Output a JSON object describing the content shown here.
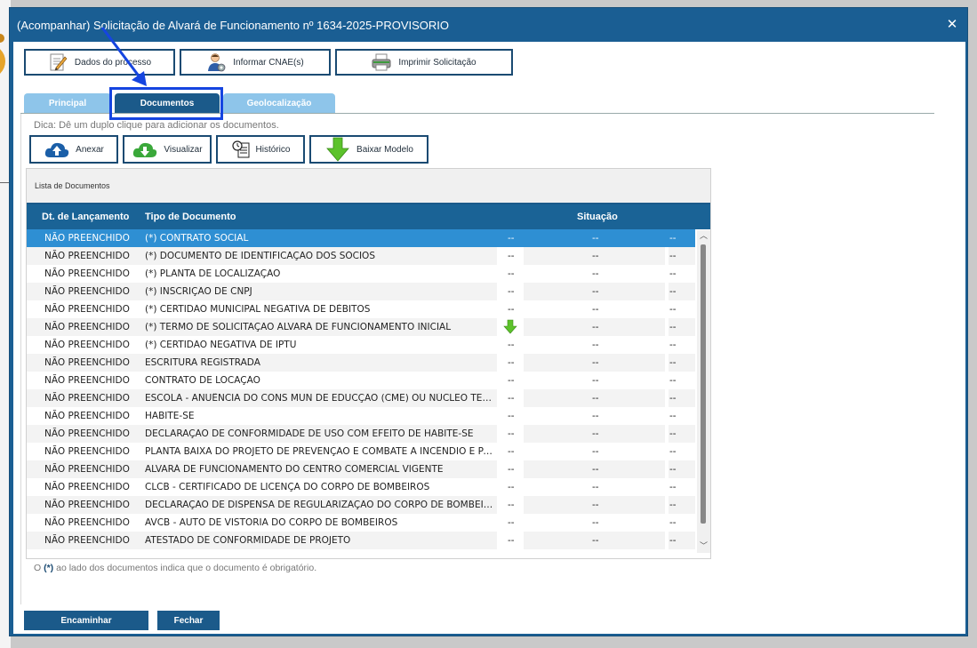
{
  "dialog": {
    "title": "(Acompanhar) Solicitação de Alvará de Funcionamento nº 1634-2025-PROVISORIO",
    "close_glyph": "✕"
  },
  "toolbar": [
    {
      "label": "Dados do processo",
      "icon": "edit-document-icon"
    },
    {
      "label": "Informar CNAE(s)",
      "icon": "user-settings-icon"
    },
    {
      "label": "Imprimir Solicitação",
      "icon": "printer-icon"
    }
  ],
  "tabs": [
    {
      "label": "Principal"
    },
    {
      "label": "Documentos",
      "active": true
    },
    {
      "label": "Geolocalização"
    }
  ],
  "hint": "Dica: Dê um duplo clique para adicionar os documentos.",
  "actions": [
    {
      "label": "Anexar",
      "icon": "cloud-upload-icon"
    },
    {
      "label": "Visualizar",
      "icon": "cloud-download-icon"
    },
    {
      "label": "Histórico",
      "icon": "history-icon"
    },
    {
      "label": "Baixar Modelo",
      "icon": "download-arrow-icon"
    }
  ],
  "list": {
    "caption": "Lista de Documentos",
    "columns": {
      "date": "Dt. de Lançamento",
      "type": "Tipo de Documento",
      "status": "Situação"
    },
    "rows": [
      {
        "date": "NÃO PREENCHIDO",
        "type": "(*) CONTRATO SOCIAL",
        "a": "--",
        "b": "--",
        "d": "--"
      },
      {
        "date": "NÃO PREENCHIDO",
        "type": "(*) DOCUMENTO DE IDENTIFICAÇÃO DOS SÓCIOS",
        "a": "--",
        "b": "--",
        "d": "--"
      },
      {
        "date": "NÃO PREENCHIDO",
        "type": "(*) PLANTA DE LOCALIZAÇÃO",
        "a": "--",
        "b": "--",
        "d": "--"
      },
      {
        "date": "NÃO PREENCHIDO",
        "type": "(*) INSCRIÇÃO DE CNPJ",
        "a": "--",
        "b": "--",
        "d": "--"
      },
      {
        "date": "NÃO PREENCHIDO",
        "type": "(*) CERTIDÃO MUNICIPAL NEGATIVA DE DÉBITOS",
        "a": "--",
        "b": "--",
        "d": "--"
      },
      {
        "date": "NÃO PREENCHIDO",
        "type": "(*) TERMO DE SOLICITAÇÃO ALVARÁ DE FUNCIONAMENTO INICIAL",
        "a": "",
        "download": true,
        "b": "--",
        "d": "--"
      },
      {
        "date": "NÃO PREENCHIDO",
        "type": "(*) CERTIDÃO NEGATIVA DE IPTU",
        "a": "--",
        "b": "--",
        "d": "--"
      },
      {
        "date": "NÃO PREENCHIDO",
        "type": "ESCRITURA REGISTRADA",
        "a": "--",
        "b": "--",
        "d": "--"
      },
      {
        "date": "NÃO PREENCHIDO",
        "type": "CONTRATO DE LOCAÇÃO",
        "a": "--",
        "b": "--",
        "d": "--"
      },
      {
        "date": "NÃO PREENCHIDO",
        "type": "ESCOLA - ANUÊNCIA DO CONS MUN DE EDUCÇÃO (CME) OU NÚCLEO TERRIT ...",
        "a": "--",
        "b": "--",
        "d": "--"
      },
      {
        "date": "NÃO PREENCHIDO",
        "type": "HABITE-SE",
        "a": "--",
        "b": "--",
        "d": "--"
      },
      {
        "date": "NÃO PREENCHIDO",
        "type": "DECLARAÇÃO DE CONFORMIDADE DE USO COM EFEITO DE HABITE-SE",
        "a": "--",
        "b": "--",
        "d": "--"
      },
      {
        "date": "NÃO PREENCHIDO",
        "type": "PLANTA BAIXA DO PROJETO DE PREVENÇÃO E COMBATE A INCÊNDIO E PÂNICO...",
        "a": "--",
        "b": "--",
        "d": "--"
      },
      {
        "date": "NÃO PREENCHIDO",
        "type": "ALVARÁ DE FUNCIONAMENTO DO CENTRO COMERCIAL VIGENTE",
        "a": "--",
        "b": "--",
        "d": "--"
      },
      {
        "date": "NÃO PREENCHIDO",
        "type": "CLCB - CERTIFICADO DE LICENÇA DO CORPO DE BOMBEIROS",
        "a": "--",
        "b": "--",
        "d": "--"
      },
      {
        "date": "NÃO PREENCHIDO",
        "type": "DECLARAÇÃO DE DISPENSA DE REGULARIZAÇÃO DO CORPO DE BOMBEIROS",
        "a": "--",
        "b": "--",
        "d": "--"
      },
      {
        "date": "NÃO PREENCHIDO",
        "type": "AVCB - AUTO DE VISTORIA DO CORPO DE BOMBEIROS",
        "a": "--",
        "b": "--",
        "d": "--"
      },
      {
        "date": "NÃO PREENCHIDO",
        "type": "ATESTADO DE CONFORMIDADE DE PROJETO",
        "a": "--",
        "b": "--",
        "d": "--"
      }
    ]
  },
  "footnote": {
    "prefix": "O ",
    "marker": "(*)",
    "suffix": " ao lado dos documentos indica que o documento é obrigatório."
  },
  "footer": {
    "forward_label": "Encaminhar",
    "close_label": "Fechar"
  },
  "colors": {
    "brand": "#1a5e93",
    "tab_inactive": "#8ec5ea",
    "selected_row": "#2e8fd3",
    "annotation": "#1545e0"
  }
}
